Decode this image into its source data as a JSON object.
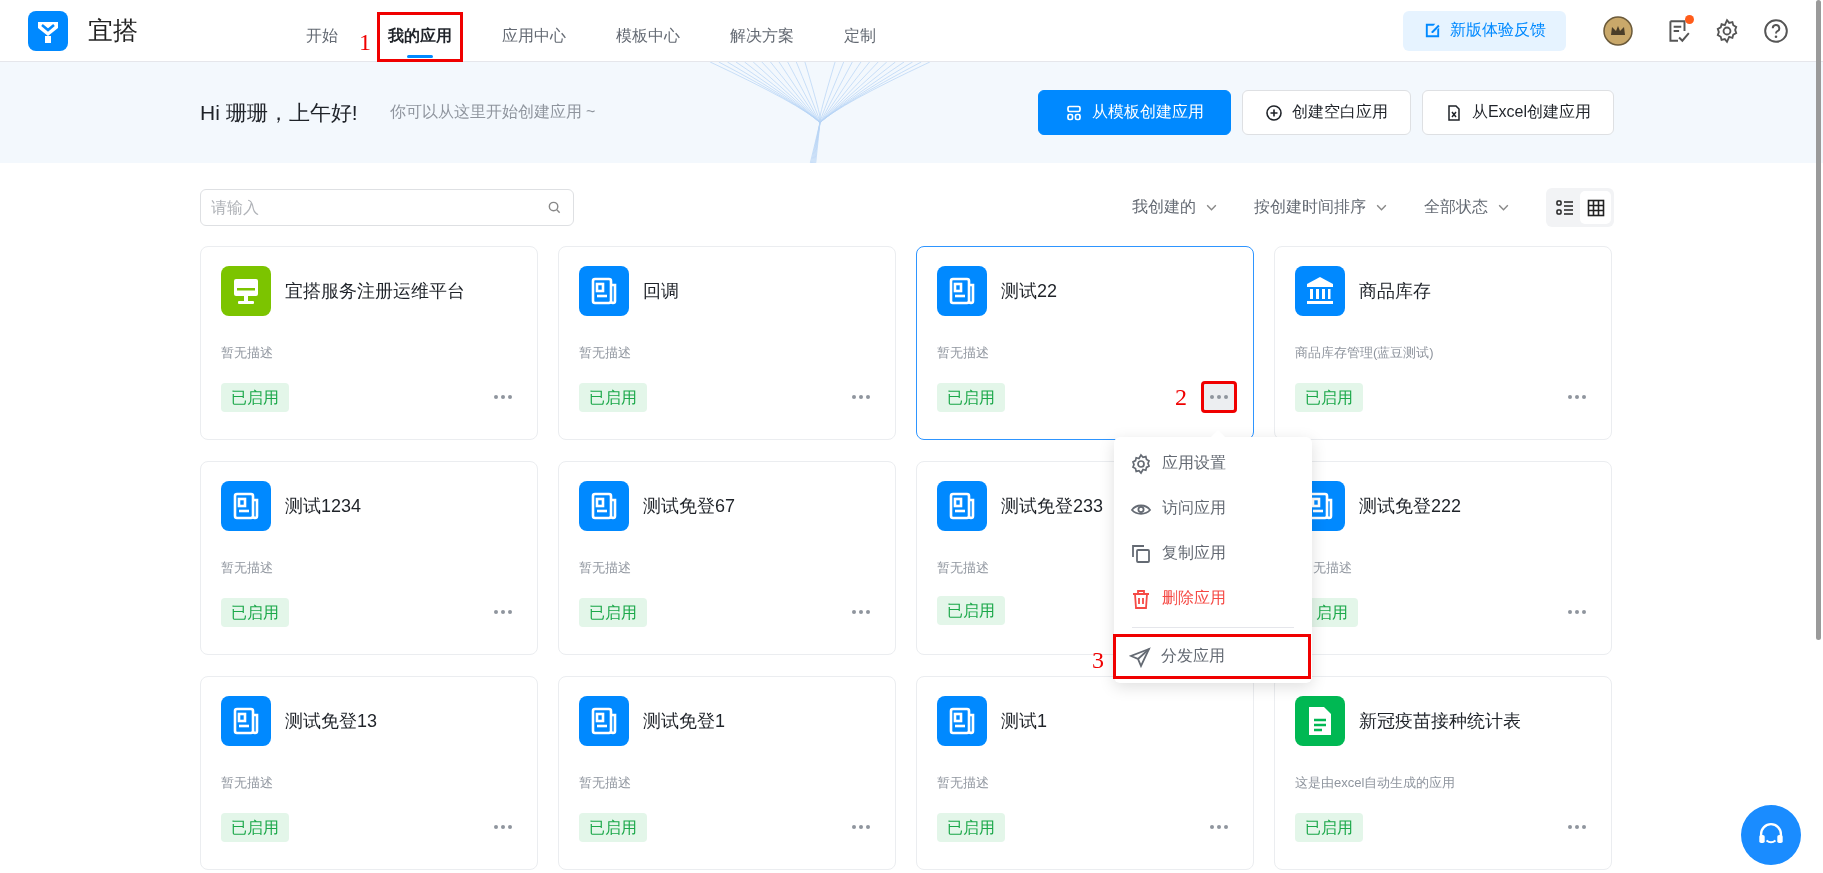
{
  "header": {
    "logo_text": "宜搭",
    "nav": [
      {
        "label": "开始",
        "selected": false
      },
      {
        "label": "我的应用",
        "selected": true,
        "annotation": "1"
      },
      {
        "label": "应用中心",
        "selected": false
      },
      {
        "label": "模板中心",
        "selected": false
      },
      {
        "label": "解决方案",
        "selected": false
      },
      {
        "label": "定制",
        "selected": false
      }
    ],
    "feedback_button": "新版体验反馈",
    "notification_dot": true
  },
  "banner": {
    "greeting": "Hi 珊珊，上午好!",
    "subtitle": "你可以从这里开始创建应用 ~",
    "buttons": [
      {
        "label": "从模板创建应用",
        "primary": true,
        "kind": "template"
      },
      {
        "label": "创建空白应用",
        "primary": false,
        "kind": "blank"
      },
      {
        "label": "从Excel创建应用",
        "primary": false,
        "kind": "excel"
      }
    ]
  },
  "toolbar": {
    "search": {
      "placeholder": "请输入"
    },
    "filters": [
      "我创建的",
      "按创建时间排序",
      "全部状态"
    ],
    "views": [
      {
        "kind": "list",
        "selected": false
      },
      {
        "kind": "grid",
        "selected": true
      }
    ]
  },
  "cards": [
    {
      "name": "宜搭服务注册运维平台",
      "kind": "monitor",
      "color": "#7cc400",
      "description": "暂无描述",
      "status": "已启用",
      "selected": false,
      "more": true,
      "menu_open": false,
      "covered": false
    },
    {
      "name": "回调",
      "kind": "news",
      "color": "#0089ff",
      "description": "暂无描述",
      "status": "已启用",
      "selected": false,
      "more": true,
      "menu_open": false,
      "covered": false
    },
    {
      "name": "测试22",
      "kind": "news",
      "color": "#0089ff",
      "description": "暂无描述",
      "status": "已启用",
      "selected": true,
      "more": true,
      "menu_open": true,
      "more_annotation": "2",
      "covered": false
    },
    {
      "name": "商品库存",
      "kind": "bank",
      "color": "#0089ff",
      "description": "商品库存管理(蓝豆测试)",
      "status": "已启用",
      "selected": false,
      "more": true,
      "menu_open": false,
      "covered": false
    },
    {
      "name": "测试1234",
      "kind": "news",
      "color": "#0089ff",
      "description": "暂无描述",
      "status": "已启用",
      "selected": false,
      "more": true,
      "menu_open": false,
      "covered": false
    },
    {
      "name": "测试免登67",
      "kind": "news",
      "color": "#0089ff",
      "description": "暂无描述",
      "status": "已启用",
      "selected": false,
      "more": true,
      "menu_open": false,
      "covered": false
    },
    {
      "name": "测试免登233",
      "kind": "news",
      "color": "#0089ff",
      "description": "暂无描述",
      "status": "已启用",
      "selected": false,
      "more": false,
      "menu_open": false,
      "covered": false
    },
    {
      "name": "测试免登222",
      "kind": "news",
      "color": "#0089ff",
      "description": "无描述",
      "status": "启用",
      "selected": false,
      "more": true,
      "menu_open": false,
      "covered": true
    },
    {
      "name": "测试免登13",
      "kind": "news",
      "color": "#0089ff",
      "description": "暂无描述",
      "status": "已启用",
      "selected": false,
      "more": true,
      "menu_open": false,
      "covered": false
    },
    {
      "name": "测试免登1",
      "kind": "news",
      "color": "#0089ff",
      "description": "暂无描述",
      "status": "已启用",
      "selected": false,
      "more": true,
      "menu_open": false,
      "covered": false
    },
    {
      "name": "测试1",
      "kind": "news",
      "color": "#0089ff",
      "description": "暂无描述",
      "status": "已启用",
      "selected": false,
      "more": true,
      "menu_open": false,
      "covered": false
    },
    {
      "name": "新冠疫苗接种统计表",
      "kind": "sheet",
      "color": "#00b853",
      "description": "这是由excel自动生成的应用",
      "status": "已启用",
      "selected": false,
      "more": true,
      "menu_open": false,
      "covered": false
    }
  ],
  "card_menu": {
    "items": [
      {
        "label": "应用设置",
        "kind": "settings",
        "danger": false
      },
      {
        "label": "访问应用",
        "kind": "visit",
        "danger": false
      },
      {
        "label": "复制应用",
        "kind": "copy",
        "danger": false
      },
      {
        "label": "删除应用",
        "kind": "delete",
        "danger": true
      },
      {
        "label": "分发应用",
        "kind": "distribute",
        "danger": false,
        "divider_before": true,
        "annotation": "3"
      }
    ]
  }
}
